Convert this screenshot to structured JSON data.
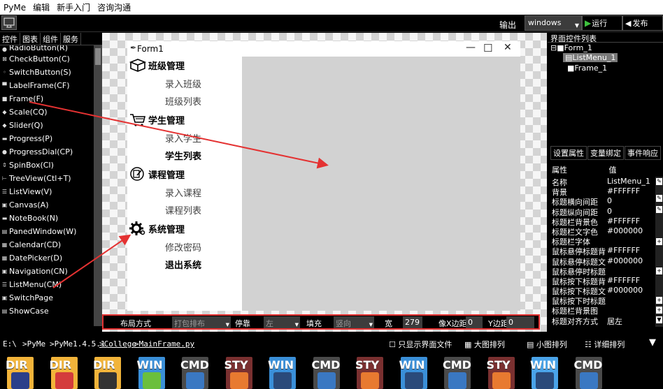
{
  "menubar": {
    "items": [
      "PyMe",
      "编辑",
      "新手入门",
      "咨询沟通"
    ]
  },
  "toolbar": {
    "output_label": "输出",
    "platform_value": "windows",
    "run_label": "运行",
    "publish_label": "发布"
  },
  "left_panel": {
    "tabs": [
      "控件",
      "图表",
      "组件",
      "服务"
    ],
    "components": [
      {
        "icon": "●",
        "label": "RadioButton(R)"
      },
      {
        "icon": "⊠",
        "label": "CheckButton(C)"
      },
      {
        "icon": "◦",
        "label": "SwitchButton(S)"
      },
      {
        "icon": "▀",
        "label": "LabelFrame(CF)"
      },
      {
        "icon": "■",
        "label": "Frame(F)"
      },
      {
        "icon": "◆",
        "label": "Scale(CQ)"
      },
      {
        "icon": "◆",
        "label": "Slider(Q)"
      },
      {
        "icon": "▬",
        "label": "Progress(P)"
      },
      {
        "icon": "●",
        "label": "ProgressDial(CP)"
      },
      {
        "icon": "⇕",
        "label": "SpinBox(CI)"
      },
      {
        "icon": "⊢",
        "label": "TreeView(Ctl+T)"
      },
      {
        "icon": "☰",
        "label": "ListView(V)"
      },
      {
        "icon": "▣",
        "label": "Canvas(A)"
      },
      {
        "icon": "▬",
        "label": "NoteBook(N)"
      },
      {
        "icon": "▤",
        "label": "PanedWindow(W)"
      },
      {
        "icon": "▦",
        "label": "Calendar(CD)"
      },
      {
        "icon": "▦",
        "label": "DatePicker(D)"
      },
      {
        "icon": "▣",
        "label": "Navigation(CN)"
      },
      {
        "icon": "☰",
        "label": "ListMenu(CM)"
      },
      {
        "icon": "▣",
        "label": "SwitchPage"
      },
      {
        "icon": "▤",
        "label": "ShowCase"
      }
    ]
  },
  "form": {
    "title": "Form1",
    "menu": [
      {
        "header": "班级管理",
        "items": [
          {
            "label": "录入班级",
            "bold": false
          },
          {
            "label": "班级列表",
            "bold": false
          }
        ]
      },
      {
        "header": "学生管理",
        "items": [
          {
            "label": "录入学生",
            "bold": false
          },
          {
            "label": "学生列表",
            "bold": true
          }
        ]
      },
      {
        "header": "课程管理",
        "items": [
          {
            "label": "录入课程",
            "bold": false
          },
          {
            "label": "课程列表",
            "bold": false
          }
        ]
      },
      {
        "header": "系统管理",
        "items": [
          {
            "label": "修改密码",
            "bold": false
          },
          {
            "label": "退出系统",
            "bold": true
          }
        ]
      }
    ]
  },
  "props_bar": {
    "layout_label": "布局方式",
    "layout_value": "打包排布",
    "dock_label": "停靠",
    "dock_value": "左",
    "fill_label": "填充",
    "fill_value": "竖向",
    "width_label": "宽",
    "width_value": "279",
    "padx_label": "像X边距",
    "padx_value": "0",
    "pady_label": "Y边距",
    "pady_value": "0"
  },
  "right_panel": {
    "tree_title": "界面控件列表",
    "tree": [
      {
        "label": "Form_1",
        "prefix": "⊟■"
      },
      {
        "label": "ListMenu_1",
        "prefix": "▤"
      },
      {
        "label": "Frame_1",
        "prefix": "■"
      }
    ],
    "tabs": [
      "设置属性",
      "变量绑定",
      "事件响应"
    ],
    "attr_headers": {
      "name": "属性",
      "value": "值"
    },
    "attributes": [
      {
        "key": "名称",
        "value": "ListMenu_1"
      },
      {
        "key": "背景",
        "value": "#FFFFFF"
      },
      {
        "key": "标题横向间距",
        "value": "0"
      },
      {
        "key": "标题纵向间距",
        "value": "0"
      },
      {
        "key": "标题栏背景色",
        "value": "#FFFFFF"
      },
      {
        "key": "标题栏文字色",
        "value": "#000000"
      },
      {
        "key": "标题栏字体",
        "value": ""
      },
      {
        "key": "鼠标悬停标题背",
        "value": "#FFFFFF"
      },
      {
        "key": "鼠标悬停标题文",
        "value": "#000000"
      },
      {
        "key": "鼠标悬停时标题",
        "value": ""
      },
      {
        "key": "鼠标按下标题背",
        "value": "#FFFFFF"
      },
      {
        "key": "鼠标按下标题文",
        "value": "#000000"
      },
      {
        "key": "鼠标按下时标题",
        "value": ""
      },
      {
        "key": "标题栏背景图",
        "value": ""
      },
      {
        "key": "标题对齐方式",
        "value": "居左"
      }
    ]
  },
  "path_bar": {
    "drive": "E:\\",
    "crumbs": [
      ">PyMe",
      ">PyMe1.4.5.1",
      ">College",
      ">MainFrame.py"
    ],
    "only_ui_label": "只显示界面文件",
    "view_large": "大图排列",
    "view_small": "小图排列",
    "view_detail": "详细排列"
  },
  "files": [
    {
      "type": "DIR",
      "color": "#f2b43a",
      "sub_color": "#2b3f8a"
    },
    {
      "type": "DIR",
      "color": "#f2b43a",
      "sub_color": "#d43c3c"
    },
    {
      "type": "DIR",
      "color": "#f2b43a",
      "sub_color": "#333333"
    },
    {
      "type": "WIN",
      "color": "#3a8fd8",
      "sub_color": "#6bbf3c"
    },
    {
      "type": "CMD",
      "color": "#4a4a4a",
      "sub_color": "#3a78c2"
    },
    {
      "type": "STY",
      "color": "#7a3030",
      "sub_color": "#e87a30"
    },
    {
      "type": "WIN",
      "color": "#3a8fd8",
      "sub_color": "#2a4a7a"
    },
    {
      "type": "CMD",
      "color": "#4a4a4a",
      "sub_color": "#3a78c2"
    },
    {
      "type": "STY",
      "color": "#7a3030",
      "sub_color": "#e87a30"
    },
    {
      "type": "WIN",
      "color": "#3a8fd8",
      "sub_color": "#2a4a7a"
    },
    {
      "type": "CMD",
      "color": "#4a4a4a",
      "sub_color": "#3a78c2"
    },
    {
      "type": "STY",
      "color": "#7a3030",
      "sub_color": "#e87a30"
    },
    {
      "type": "WIN",
      "color": "#4aa3e8",
      "sub_color": "#2a4a7a"
    },
    {
      "type": "CMD",
      "color": "#4a4a4a",
      "sub_color": "#3a78c2"
    }
  ],
  "colors": {
    "highlight_red": "#e43232",
    "frame_gray": "#d2d2d2",
    "tree_select": "#7a7a7a"
  }
}
